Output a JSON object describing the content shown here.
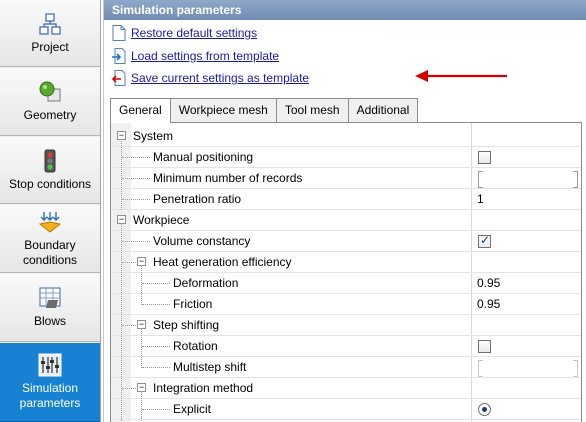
{
  "sidebar": {
    "items": [
      {
        "label": "Project",
        "icon": "project-icon",
        "active": false
      },
      {
        "label": "Geometry",
        "icon": "geometry-icon",
        "active": false
      },
      {
        "label": "Stop conditions",
        "icon": "traffic-light-icon",
        "active": false
      },
      {
        "label": "Boundary\nconditions",
        "icon": "boundary-arrows-icon",
        "active": false
      },
      {
        "label": "Blows",
        "icon": "blows-icon",
        "active": false
      },
      {
        "label": "Simulation\nparameters",
        "icon": "sliders-icon",
        "active": true
      }
    ]
  },
  "panel": {
    "title": "Simulation parameters"
  },
  "links": {
    "restore": "Restore default settings",
    "load": "Load settings from template",
    "save": "Save current settings as template"
  },
  "tabs": [
    {
      "label": "General",
      "active": true
    },
    {
      "label": "Workpiece mesh",
      "active": false
    },
    {
      "label": "Tool mesh",
      "active": false
    },
    {
      "label": "Additional",
      "active": false
    }
  ],
  "tree": {
    "system": {
      "label": "System",
      "toggle": "−"
    },
    "manual_positioning": {
      "label": "Manual positioning",
      "checked": false
    },
    "min_records": {
      "label": "Minimum number of records",
      "value": ""
    },
    "penetration_ratio": {
      "label": "Penetration ratio",
      "value": "1"
    },
    "workpiece": {
      "label": "Workpiece",
      "toggle": "−"
    },
    "volume_constancy": {
      "label": "Volume constancy",
      "checked": true
    },
    "heat_gen": {
      "label": "Heat generation efficiency",
      "toggle": "−"
    },
    "deformation": {
      "label": "Deformation",
      "value": "0.95"
    },
    "friction": {
      "label": "Friction",
      "value": "0.95"
    },
    "step_shifting": {
      "label": "Step shifting",
      "toggle": "−"
    },
    "rotation": {
      "label": "Rotation",
      "checked": false
    },
    "multistep_shift": {
      "label": "Multistep shift",
      "value": ""
    },
    "integration_method": {
      "label": "Integration method",
      "toggle": "−"
    },
    "explicit": {
      "label": "Explicit",
      "selected": true
    }
  },
  "colors": {
    "active_nav": "#1782d4",
    "header": "#7a96bc",
    "link": "#1a1aa6",
    "arrow": "#d40000"
  }
}
